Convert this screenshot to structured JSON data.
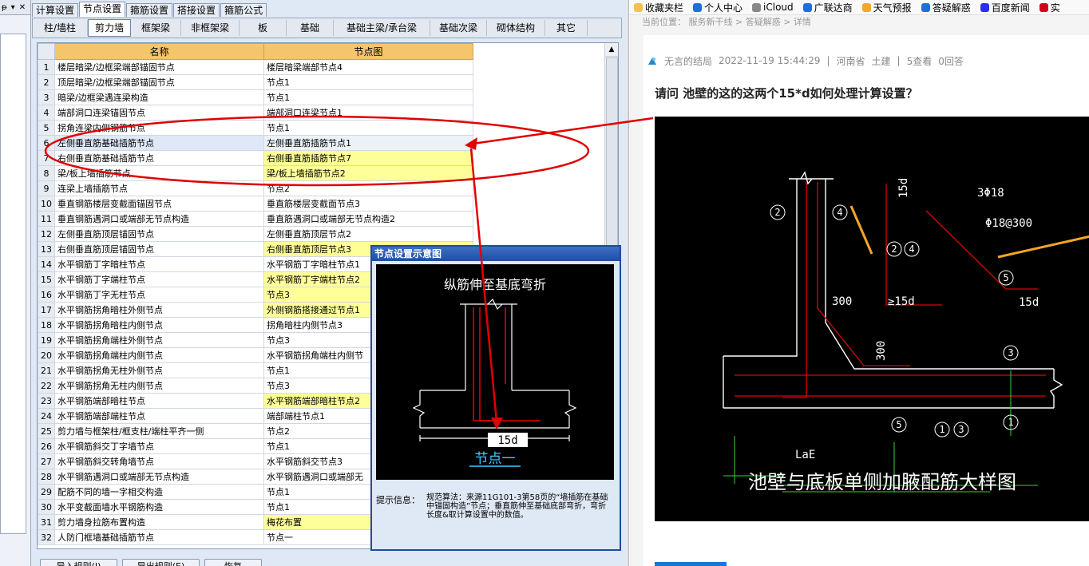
{
  "left_app": {
    "mini_panel": {
      "icon_text": "ᵽ",
      "pin": "▾",
      "close": "✕"
    },
    "top_tabs": [
      "计算设置",
      "节点设置",
      "箍筋设置",
      "搭接设置",
      "箍筋公式"
    ],
    "category_tabs": [
      "柱/墙柱",
      "剪力墙",
      "框架梁",
      "非框架梁",
      "板",
      "基础",
      "基础主梁/承台梁",
      "基础次梁",
      "砌体结构",
      "其它"
    ],
    "table": {
      "headers": [
        "",
        "名称",
        "节点图"
      ],
      "rows": [
        {
          "no": "1",
          "name": "楼层暗梁/边框梁端部锚固节点",
          "node": "楼层暗梁端部节点4",
          "hl": false
        },
        {
          "no": "2",
          "name": "顶层暗梁/边框梁端部锚固节点",
          "node": "节点1",
          "hl": false
        },
        {
          "no": "3",
          "name": "暗梁/边框梁遇连梁构造",
          "node": "节点1",
          "hl": false
        },
        {
          "no": "4",
          "name": "端部洞口连梁锚固节点",
          "node": "端部洞口连梁节点1",
          "hl": false
        },
        {
          "no": "5",
          "name": "拐角连梁内侧钢筋节点",
          "node": "节点1",
          "hl": false
        },
        {
          "no": "6",
          "name": "左侧垂直筋基础插筋节点",
          "node": "左侧垂直筋插筋节点1",
          "hl": false
        },
        {
          "no": "7",
          "name": "右侧垂直筋基础插筋节点",
          "node": "右侧垂直筋插筋节点7",
          "hl": true
        },
        {
          "no": "8",
          "name": "梁/板上墙插筋节点",
          "node": "梁/板上墙插筋节点2",
          "hl": true
        },
        {
          "no": "9",
          "name": "连梁上墙插筋节点",
          "node": "节点2",
          "hl": false
        },
        {
          "no": "10",
          "name": "垂直钢筋楼层变截面锚固节点",
          "node": "垂直筋楼层变截面节点3",
          "hl": false
        },
        {
          "no": "11",
          "name": "垂直钢筋遇洞口或端部无节点构造",
          "node": "垂直筋遇洞口或端部无节点构造2",
          "hl": false
        },
        {
          "no": "12",
          "name": "左侧垂直筋顶层锚固节点",
          "node": "左侧垂直筋顶层节点2",
          "hl": false
        },
        {
          "no": "13",
          "name": "右侧垂直筋顶层锚固节点",
          "node": "右侧垂直筋顶层节点3",
          "hl": true
        },
        {
          "no": "14",
          "name": "水平钢筋丁字暗柱节点",
          "node": "水平钢筋丁字暗柱节点1",
          "hl": false
        },
        {
          "no": "15",
          "name": "水平钢筋丁字端柱节点",
          "node": "水平钢筋丁字端柱节点2",
          "hl": true
        },
        {
          "no": "16",
          "name": "水平钢筋丁字无柱节点",
          "node": "节点3",
          "hl": true
        },
        {
          "no": "17",
          "name": "水平钢筋拐角暗柱外侧节点",
          "node": "外侧钢筋搭接通过节点1",
          "hl": true
        },
        {
          "no": "18",
          "name": "水平钢筋拐角暗柱内侧节点",
          "node": "拐角暗柱内侧节点3",
          "hl": false
        },
        {
          "no": "19",
          "name": "水平钢筋拐角端柱外侧节点",
          "node": "节点3",
          "hl": false
        },
        {
          "no": "20",
          "name": "水平钢筋拐角端柱内侧节点",
          "node": "水平钢筋拐角端柱内侧节",
          "hl": false
        },
        {
          "no": "21",
          "name": "水平钢筋拐角无柱外侧节点",
          "node": "节点1",
          "hl": false
        },
        {
          "no": "22",
          "name": "水平钢筋拐角无柱内侧节点",
          "node": "节点3",
          "hl": false
        },
        {
          "no": "23",
          "name": "水平钢筋端部暗柱节点",
          "node": "水平钢筋端部暗柱节点2",
          "hl": true
        },
        {
          "no": "24",
          "name": "水平钢筋端部端柱节点",
          "node": "端部端柱节点1",
          "hl": false
        },
        {
          "no": "25",
          "name": "剪力墙与框架柱/框支柱/端柱平齐一侧",
          "node": "节点2",
          "hl": false
        },
        {
          "no": "26",
          "name": "水平钢筋斜交丁字墙节点",
          "node": "节点1",
          "hl": false
        },
        {
          "no": "27",
          "name": "水平钢筋斜交转角墙节点",
          "node": "水平钢筋斜交节点3",
          "hl": false
        },
        {
          "no": "28",
          "name": "水平钢筋遇洞口或端部无节点构造",
          "node": "水平钢筋遇洞口或端部无",
          "hl": false
        },
        {
          "no": "29",
          "name": "配筋不同的墙一字相交构造",
          "node": "节点1",
          "hl": false
        },
        {
          "no": "30",
          "name": "水平变截面墙水平钢筋构造",
          "node": "节点1",
          "hl": false
        },
        {
          "no": "31",
          "name": "剪力墙身拉筋布置构造",
          "node": "梅花布置",
          "hl": true
        },
        {
          "no": "32",
          "name": "人防门框墙基础插筋节点",
          "node": "节点一",
          "hl": false
        }
      ]
    },
    "bottom_buttons": [
      "导入规则(I)",
      "导出规则(E)",
      "恢复"
    ],
    "popup": {
      "title": "节点设置示意图",
      "diagram_title": "纵筋伸至基底弯折",
      "dim_label": "15d",
      "node_label": "节点一",
      "hint_label": "提示信息：",
      "hint_text": "规范算法：来源11G101-3第58页的“墙插筋在基础中锚固构造”节点；垂直筋伸至基础底部弯折，弯折长度&取计算设置中的数值。"
    }
  },
  "browser": {
    "bookmarks": [
      {
        "label": "收藏夹栏",
        "icon": "folder-icon",
        "color": "#f3c24a"
      },
      {
        "label": "个人中心",
        "icon": "glodon-icon",
        "color": "#1e6fd9"
      },
      {
        "label": "iCloud",
        "icon": "apple-icon",
        "color": "#888888"
      },
      {
        "label": "广联达商",
        "icon": "g-logo-icon",
        "color": "#1e6fd9"
      },
      {
        "label": "天气预报",
        "icon": "weather-icon",
        "color": "#f5a623"
      },
      {
        "label": "答疑解惑",
        "icon": "glodon-icon",
        "color": "#1e6fd9"
      },
      {
        "label": "百度新闻",
        "icon": "baidu-icon",
        "color": "#2932e1"
      },
      {
        "label": "实",
        "icon": "red-icon",
        "color": "#d0021b"
      }
    ],
    "breadcrumb": "当前位置：  服务新干线  >  答疑解惑  >  详情",
    "meta": {
      "author": "无言的结局",
      "datetime": "2022-11-19 15:44:29",
      "location": "河南省",
      "category": "土建",
      "views": "5查看",
      "answers": "0回答",
      "separator": "|"
    },
    "question": "请问 池壁的这的这两个15*d如何处理计算设置？",
    "drawing": {
      "labels": {
        "c2": "2",
        "c4": "4",
        "c24a": "2",
        "c24b": "4",
        "c5top": "5",
        "c3": "3",
        "c5bot": "5",
        "c1": "1",
        "c13a": "1",
        "c13b": "3",
        "c1r": "1",
        "d15_top": "15d",
        "d15_mid": "≥15d",
        "d15_right": "15d",
        "bar1": "3Φ18",
        "bar2": "Φ18@300",
        "dim300a": "300",
        "dim300b": "300",
        "lae": "LaE",
        "caption": "池壁与底板单侧加腋配筋大样图"
      }
    }
  },
  "colors": {
    "highlight": "#ffff99",
    "header": "#f5c56b",
    "annotation_red": "#e00000",
    "link_blue": "#1677d9"
  }
}
